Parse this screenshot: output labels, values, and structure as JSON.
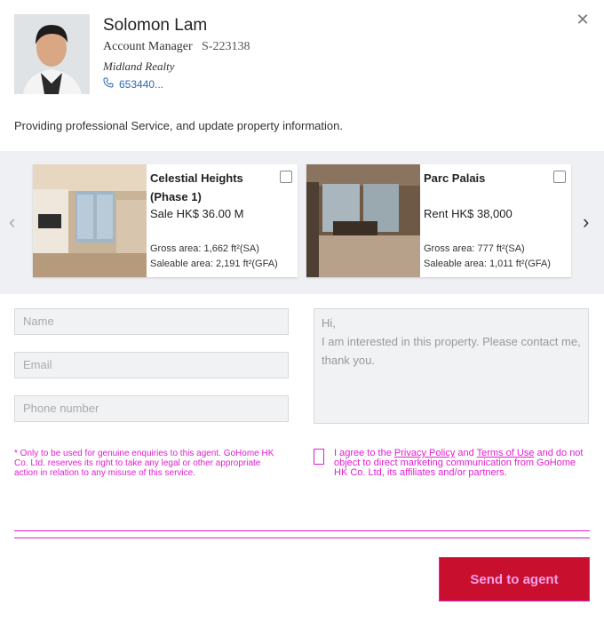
{
  "agent": {
    "name": "Solomon Lam",
    "role": "Account Manager",
    "license_id": "S-223138",
    "company": "Midland Realty",
    "phone": "653440..."
  },
  "intro_text": "Providing professional Service, and update property information.",
  "listings": [
    {
      "title": "Celestial Heights (Phase 1)",
      "price": "Sale HK$ 36.00 M",
      "gross_area": "Gross area: 1,662 ft²(SA)",
      "saleable_area": "Saleable area: 2,191 ft²(GFA)",
      "checked": false
    },
    {
      "title": "Parc Palais",
      "price": "Rent HK$ 38,000",
      "gross_area": "Gross area: 777 ft²(SA)",
      "saleable_area": "Saleable area: 1,011 ft²(GFA)",
      "checked": false
    }
  ],
  "form": {
    "name_placeholder": "Name",
    "email_placeholder": "Email",
    "phone_placeholder": "Phone number",
    "message_placeholder": "Hi,\nI am interested in this property. Please contact me, thank you."
  },
  "disclaimer": "* Only to be used for genuine enquiries to this agent. GoHome HK Co. Ltd. reserves its right to take any legal or other appropriate action in relation to any misuse of this service.",
  "consent": {
    "prefix": "I agree to the ",
    "privacy_link": "Privacy Policy",
    "and": " and ",
    "terms_link": "Terms of Use",
    "suffix": " and do not object to direct marketing communication from GoHome HK Co. Ltd, its affiliates and/or partners."
  },
  "send_button": "Send to agent",
  "colors": {
    "accent_link": "#2a6ab0",
    "send_button_bg": "#c8102e",
    "highlight": "#e31dd2"
  }
}
